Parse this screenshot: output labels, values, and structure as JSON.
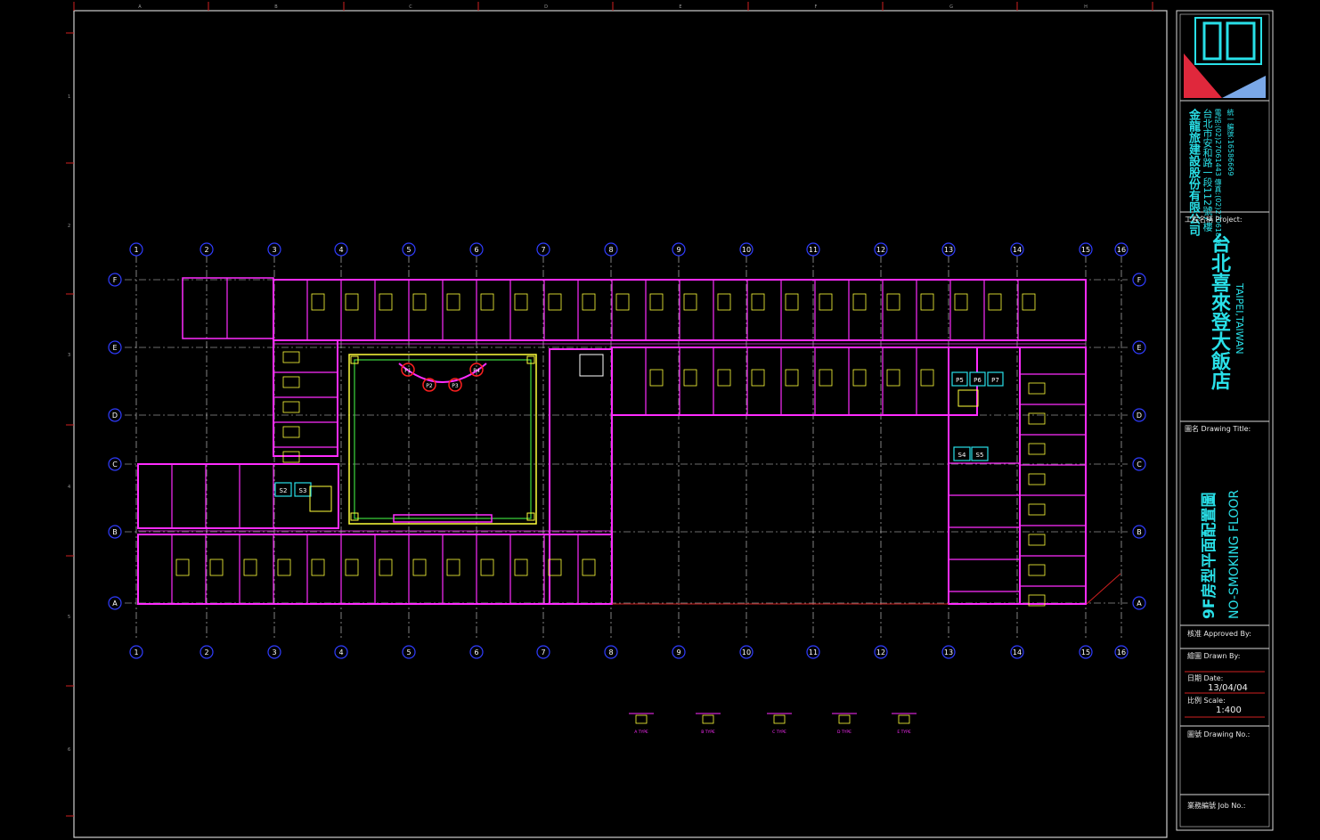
{
  "grid": {
    "col_labels_top": [
      "1",
      "2",
      "3",
      "4",
      "5",
      "6",
      "7",
      "8",
      "9",
      "10",
      "11",
      "12",
      "13",
      "14",
      "15",
      "16"
    ],
    "col_labels_bottom": [
      "1",
      "2",
      "3",
      "4",
      "5",
      "6",
      "7",
      "8",
      "9",
      "10",
      "11",
      "12",
      "13",
      "14",
      "15",
      "16"
    ],
    "row_labels": [
      "F",
      "E",
      "D",
      "C",
      "B",
      "A"
    ],
    "frame_col_letters": [
      "A",
      "B",
      "C",
      "D",
      "E",
      "F",
      "G",
      "H"
    ],
    "frame_row_numbers": [
      "1",
      "2",
      "3",
      "4",
      "5",
      "6"
    ]
  },
  "stairs": [
    "S2",
    "S3",
    "S4",
    "S5"
  ],
  "elevators": [
    "P5",
    "P6",
    "P7"
  ],
  "circle_marks": [
    "P1",
    "P2",
    "P3",
    "P4"
  ],
  "legend_types": [
    "A TYPE",
    "B TYPE",
    "C TYPE",
    "D TYPE",
    "E TYPE"
  ],
  "title_block": {
    "company": "金龍旅建設股份有限公司",
    "company_address": "台北市安和路一段112號7樓",
    "company_phone": "電話:(02)27061443 傳真:(02)27061846",
    "company_fax": "統一編號:16586669",
    "project_label": "工程名稱 Project:",
    "project_name": "台北喜來登大飯店",
    "project_location": "TAIPEI,TAIWAN",
    "drawing_title_label": "圖名 Drawing Title:",
    "drawing_title_zh": "9F房型平面配置圖",
    "drawing_title_en": "NO-SMOKING FLOOR",
    "approved_label": "核准 Approved By:",
    "drawn_label": "繪圖 Drawn By:",
    "date_label": "日期 Date:",
    "date_value": "13/04/04",
    "scale_label": "比例 Scale:",
    "scale_value": "1:400",
    "drawing_no_label": "圖號 Drawing No.:",
    "job_no_label": "業務編號 Job No.:"
  },
  "colors": {
    "background": "#000000",
    "walls": "#ff2cff",
    "grid_line": "#d8d8d8",
    "grid_bubble": "#2f3cff",
    "fixtures": "#ffff3a",
    "accent_cyan": "#29e0e8",
    "frame_ticks": "#d02020"
  }
}
